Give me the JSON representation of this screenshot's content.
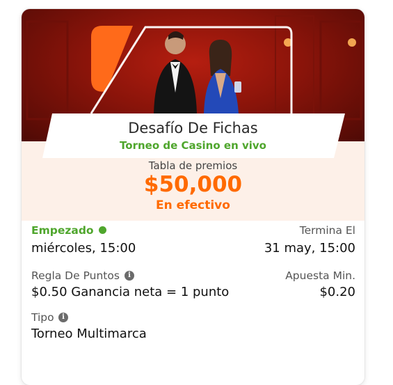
{
  "tournament": {
    "title": "Desafío De Fichas",
    "subtitle": "Torneo de Casino en vivo"
  },
  "prize": {
    "label": "Tabla de premios",
    "amount": "$50,000",
    "type": "En efectivo"
  },
  "status": {
    "label": "Empezado",
    "start_value": "miércoles, 15:00",
    "color": "#4fa62d"
  },
  "ends": {
    "label": "Termina El",
    "value": "31 may, 15:00"
  },
  "points_rule": {
    "label": "Regla De Puntos",
    "value": "$0.50 Ganancia neta = 1 punto",
    "icon": "info-icon"
  },
  "min_bet": {
    "label": "Apuesta Min.",
    "value": "$0.20"
  },
  "type": {
    "label": "Tipo",
    "value": "Torneo Multimarca",
    "icon": "info-icon"
  },
  "colors": {
    "accent": "#ff6a00",
    "success": "#4fa62d",
    "banner": "#8a140a",
    "peach_background": "#fdf0e8"
  }
}
